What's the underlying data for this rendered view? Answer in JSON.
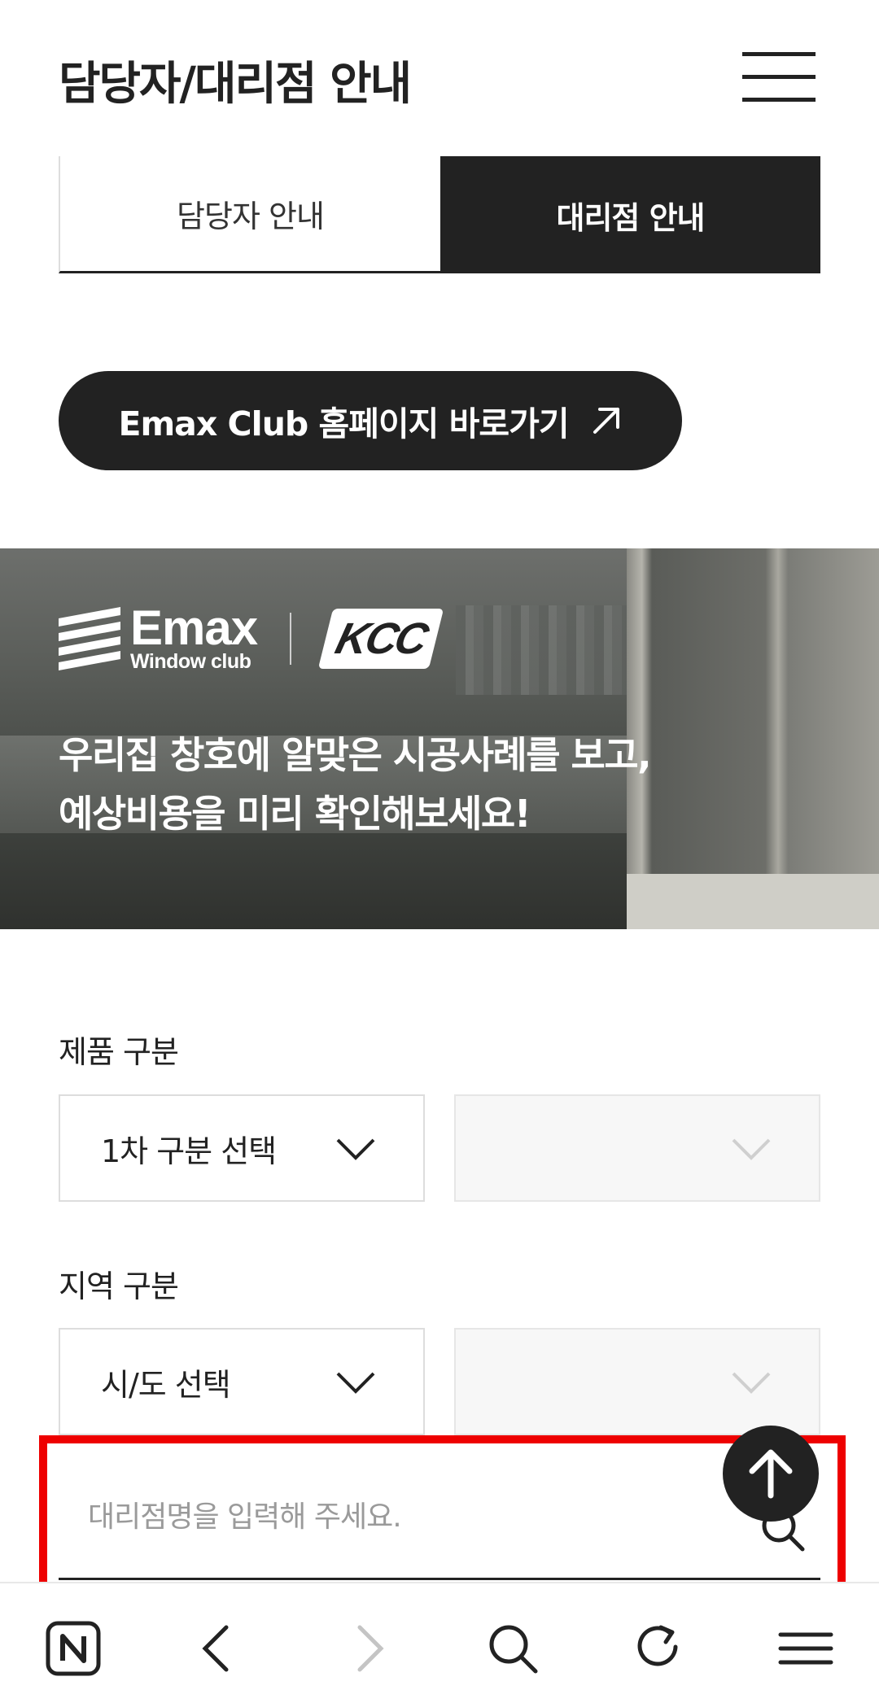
{
  "header": {
    "title": "담당자/대리점 안내",
    "menu_icon": "hamburger-menu-icon"
  },
  "tabs": [
    {
      "label": "담당자 안내",
      "active": false
    },
    {
      "label": "대리점 안내",
      "active": true
    }
  ],
  "club_link": {
    "label": "Emax Club 홈페이지 바로가기",
    "icon": "external-arrow-icon"
  },
  "banner": {
    "logo_main": "Emax",
    "logo_sub": "Window club",
    "partner_logo": "KCC",
    "line1": "우리집 창호에 알맞은 시공사례를 보고,",
    "line2": "예상비용을 미리 확인해보세요!"
  },
  "filters": {
    "product": {
      "label": "제품 구분",
      "primary_value": "1차 구분 선택",
      "secondary_value": ""
    },
    "region": {
      "label": "지역 구분",
      "primary_value": "시/도 선택",
      "secondary_value": ""
    }
  },
  "search": {
    "placeholder": "대리점명을 입력해 주세요.",
    "value": ""
  },
  "colors": {
    "dark": "#222222",
    "highlight": "#ee0000",
    "border": "#dddddd",
    "disabled_bg": "#f7f7f7"
  },
  "browser_nav": [
    "naver-home-icon",
    "back-icon",
    "forward-icon",
    "search-icon",
    "refresh-icon",
    "menu-icon"
  ]
}
